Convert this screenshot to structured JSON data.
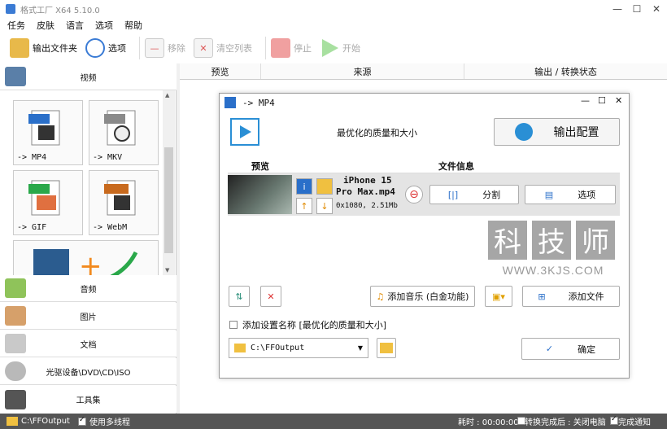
{
  "window": {
    "title": "格式工厂 X64 5.10.0"
  },
  "menu": [
    "任务",
    "皮肤",
    "语言",
    "选项",
    "帮助"
  ],
  "toolbar": {
    "output_folder": "输出文件夹",
    "options": "选项",
    "remove": "移除",
    "clear_list": "清空列表",
    "stop": "停止",
    "start": "开始"
  },
  "sidebar": {
    "video": "视频",
    "audio": "音频",
    "image": "图片",
    "document": "文档",
    "optical": "光驱设备\\DVD\\CD\\ISO",
    "tools": "工具集"
  },
  "formats": [
    {
      "badge": "MP4",
      "label": "-> MP4",
      "color": "#2a6fc9"
    },
    {
      "badge": "MKV",
      "label": "-> MKV",
      "color": "#8a8a8a"
    },
    {
      "badge": "GIF",
      "label": "-> GIF",
      "color": "#2aa84a"
    },
    {
      "badge": "WebM",
      "label": "-> WebM",
      "color": "#c86a1e"
    }
  ],
  "columns": [
    "预览",
    "来源",
    "输出 / 转换状态"
  ],
  "dialog": {
    "title": "-> MP4",
    "quality": "最优化的质量和大小",
    "output_config": "输出配置",
    "preview_header": "预览",
    "fileinfo_header": "文件信息",
    "file_name_1": "iPhone 15",
    "file_name_2": "Pro Max.mp4",
    "file_meta": "0x1080, 2.51Mb",
    "split": "分割",
    "options": "选项",
    "add_music": "添加音乐 (白金功能)",
    "add_file": "添加文件",
    "add_setting_name": "添加设置名称 [最优化的质量和大小]",
    "output_path": "C:\\FFOutput",
    "ok": "确定"
  },
  "watermark": {
    "text": "科技师",
    "url": "WWW.3KJS.COM"
  },
  "statusbar": {
    "path": "C:\\FFOutput",
    "multithread": "使用多线程",
    "elapsed": "耗时 : 00:00:00",
    "after_done": "转换完成后 : 关闭电脑",
    "notify": "完成通知"
  }
}
